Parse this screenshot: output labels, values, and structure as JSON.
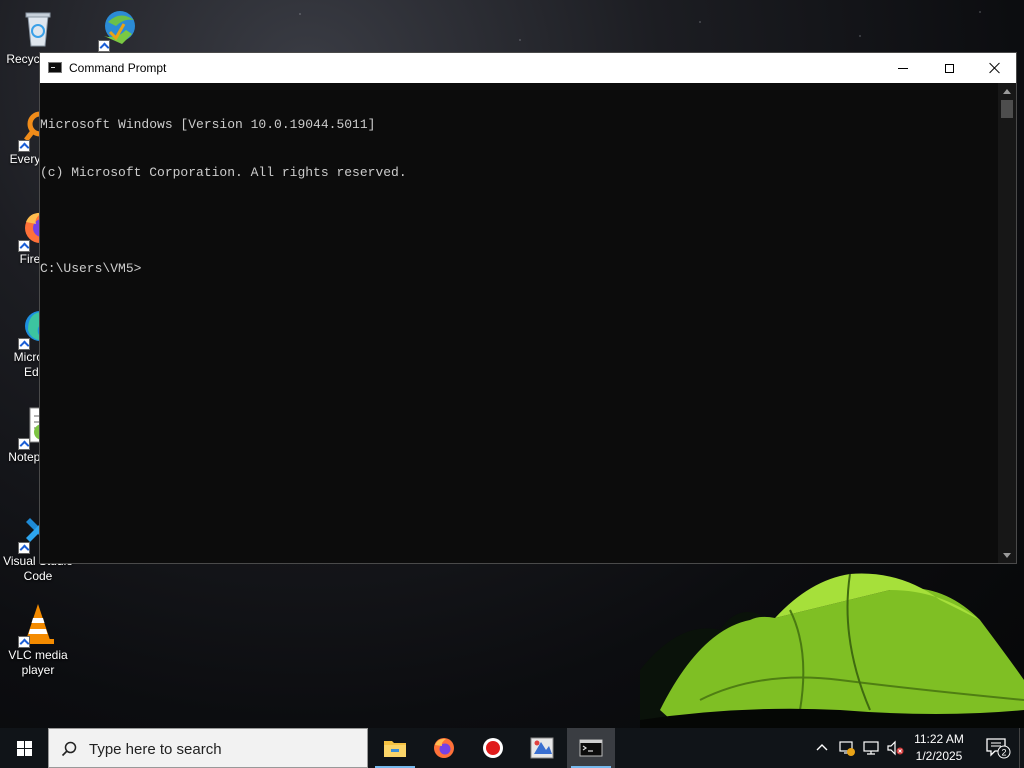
{
  "desktop": {
    "icons": [
      {
        "label": "Recycle Bin",
        "icon": "recycle-bin-icon"
      },
      {
        "label": "Internet Download Manager",
        "icon": "idm-icon"
      },
      {
        "label": "Everything",
        "icon": "everything-icon"
      },
      {
        "label": "Firefox",
        "icon": "firefox-icon"
      },
      {
        "label": "Microsoft Edge",
        "icon": "edge-icon"
      },
      {
        "label": "Notepad++",
        "icon": "notepad-plus-plus-icon"
      },
      {
        "label": "Visual Studio Code",
        "icon": "vscode-icon"
      },
      {
        "label": "VLC media player",
        "icon": "vlc-icon"
      }
    ]
  },
  "window": {
    "title": "Command Prompt",
    "icon": "cmd-icon",
    "buttons": {
      "minimize": "minimize",
      "maximize": "maximize",
      "close": "close"
    },
    "console": {
      "lines": [
        "Microsoft Windows [Version 10.0.19044.5011]",
        "(c) Microsoft Corporation. All rights reserved.",
        "",
        "C:\\Users\\VM5>"
      ]
    }
  },
  "taskbar": {
    "search_placeholder": "Type here to search",
    "apps": [
      {
        "name": "File Explorer",
        "icon": "file-explorer-icon",
        "running": true
      },
      {
        "name": "Firefox",
        "icon": "firefox-icon",
        "running": false
      },
      {
        "name": "Recorder",
        "icon": "record-icon",
        "running": false
      },
      {
        "name": "Paint",
        "icon": "paint-icon",
        "running": false
      },
      {
        "name": "Command Prompt",
        "icon": "cmd-icon",
        "running": true,
        "active": true
      }
    ],
    "tray": {
      "icons": [
        "chevron-up-icon",
        "network-error-icon",
        "monitor-icon",
        "volume-muted-icon"
      ],
      "time": "11:22 AM",
      "date": "1/2/2025",
      "notification_count": "2"
    }
  },
  "colors": {
    "console_bg": "#0c0c0c",
    "console_fg": "#cccccc",
    "taskbar_bg": "#101418",
    "accent": "#76b9ed",
    "tent_green": "#8fd22a"
  }
}
